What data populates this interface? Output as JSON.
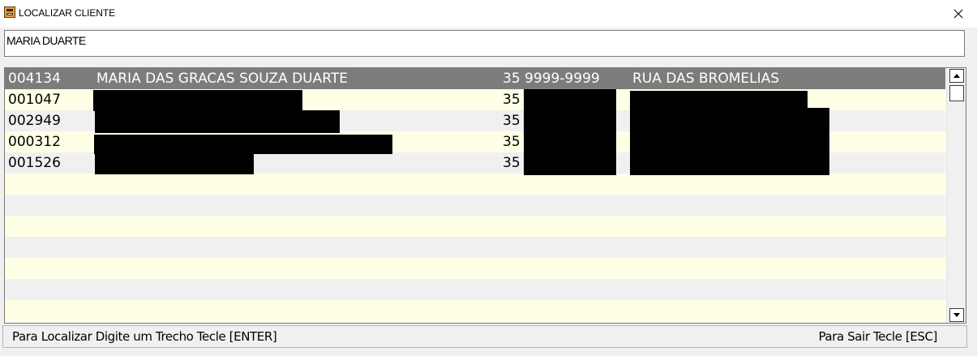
{
  "window": {
    "title": "LOCALIZAR CLIENTE",
    "icon": "cash-register-icon",
    "close_icon": "close-icon"
  },
  "search": {
    "value": "MARIA DUARTE"
  },
  "results": {
    "rows": [
      {
        "code": "004134",
        "name": "MARIA DAS GRACAS SOUZA DUARTE",
        "phone": "35 9999-9999",
        "street": "RUA DAS BROMELIAS",
        "selected": true
      },
      {
        "code": "001047",
        "name": "",
        "phone": "35",
        "street": "",
        "selected": false
      },
      {
        "code": "002949",
        "name": "",
        "phone": "35",
        "street": "",
        "selected": false
      },
      {
        "code": "000312",
        "name": "",
        "phone": "35",
        "street": "",
        "selected": false
      },
      {
        "code": "001526",
        "name": "",
        "phone": "35",
        "street": "",
        "selected": false
      }
    ]
  },
  "colors": {
    "row_odd": "#ffffe6",
    "row_even": "#f0f0f0",
    "row_selected": "#7c7c7c"
  },
  "status": {
    "left": "Para Localizar Digite um Trecho Tecle [ENTER]",
    "right": "Para Sair Tecle [ESC]"
  }
}
